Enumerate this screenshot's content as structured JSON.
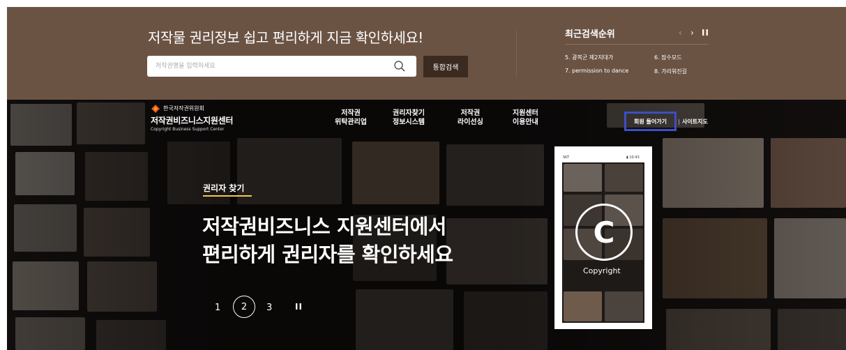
{
  "search": {
    "headline": "저작물 권리정보 쉽고 편리하게 지금 확인하세요!",
    "placeholder": "저작권명을 입력하세요",
    "value": "",
    "submit_label": "통합검색"
  },
  "recent": {
    "title": "최근검색순위",
    "prev_label": "‹",
    "next_label": "›",
    "pause_label": "II",
    "items": [
      "5. 광복군 제2지대가",
      "6. 잠수모드",
      "7. permission to dance",
      "8. 가리워진길"
    ]
  },
  "brand": {
    "org": "한국저작권위원회",
    "title": "저작권비즈니스지원센터",
    "subtitle": "Copyright Business Support Center"
  },
  "gnb": [
    {
      "line1": "저작권",
      "line2": "위탁관리업"
    },
    {
      "line1": "권리자찾기",
      "line2": "정보시스템"
    },
    {
      "line1": "저작권",
      "line2": "라이선싱"
    },
    {
      "line1": "지원센터",
      "line2": "이용안내"
    }
  ],
  "util": {
    "login": "회원 들어가기",
    "separator": "|",
    "sitemap": "사이트지도"
  },
  "hero": {
    "label": "권리자 찾기",
    "line1": "저작권비즈니스 지원센터에서",
    "line2": "편리하게 권리자를 확인하세요",
    "pager": {
      "pages": [
        "1",
        "2",
        "3"
      ],
      "active": "2",
      "pause": "II"
    }
  },
  "phone": {
    "carrier": "SKT",
    "time": "▮ 10:43",
    "symbol": "C",
    "caption": "Copyright"
  },
  "colors": {
    "topband": "#6b5344",
    "search_button": "#3a2a20",
    "highlight_box": "#3c4fc4",
    "hero_label_underline": "#f5c84a"
  }
}
